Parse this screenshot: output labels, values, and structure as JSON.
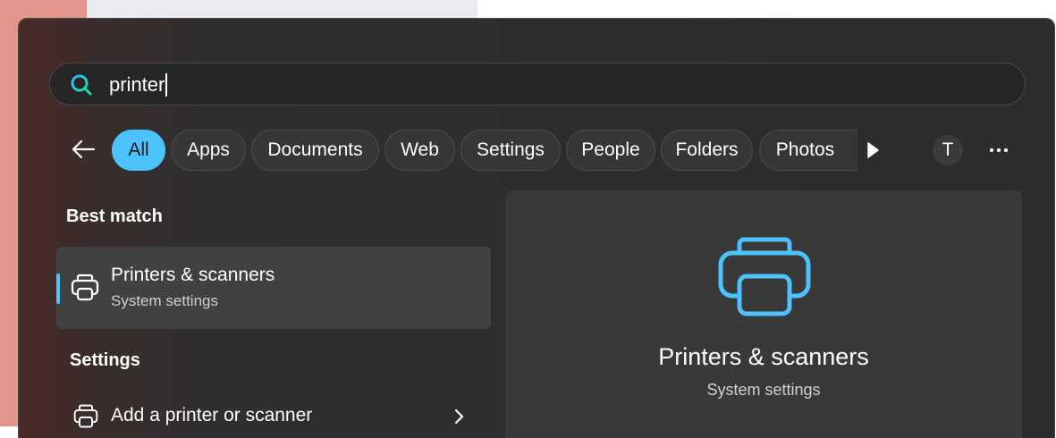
{
  "search": {
    "query": "printer"
  },
  "filters": [
    {
      "label": "All",
      "active": true
    },
    {
      "label": "Apps"
    },
    {
      "label": "Documents"
    },
    {
      "label": "Web"
    },
    {
      "label": "Settings"
    },
    {
      "label": "People"
    },
    {
      "label": "Folders"
    },
    {
      "label": "Photos"
    }
  ],
  "account": {
    "initial": "T"
  },
  "best_match": {
    "heading": "Best match",
    "title": "Printers & scanners",
    "subtitle": "System settings"
  },
  "settings_section": {
    "heading": "Settings",
    "items": [
      {
        "label": "Add a printer or scanner"
      }
    ]
  },
  "preview": {
    "title": "Printers & scanners",
    "subtitle": "System settings"
  },
  "colors": {
    "accent": "#4cc2ff",
    "panel": "#2d2d2d",
    "card": "#414141"
  },
  "icons": [
    "search-icon",
    "back-arrow-icon",
    "play-icon",
    "more-icon",
    "printer-icon",
    "chevron-right-icon"
  ]
}
